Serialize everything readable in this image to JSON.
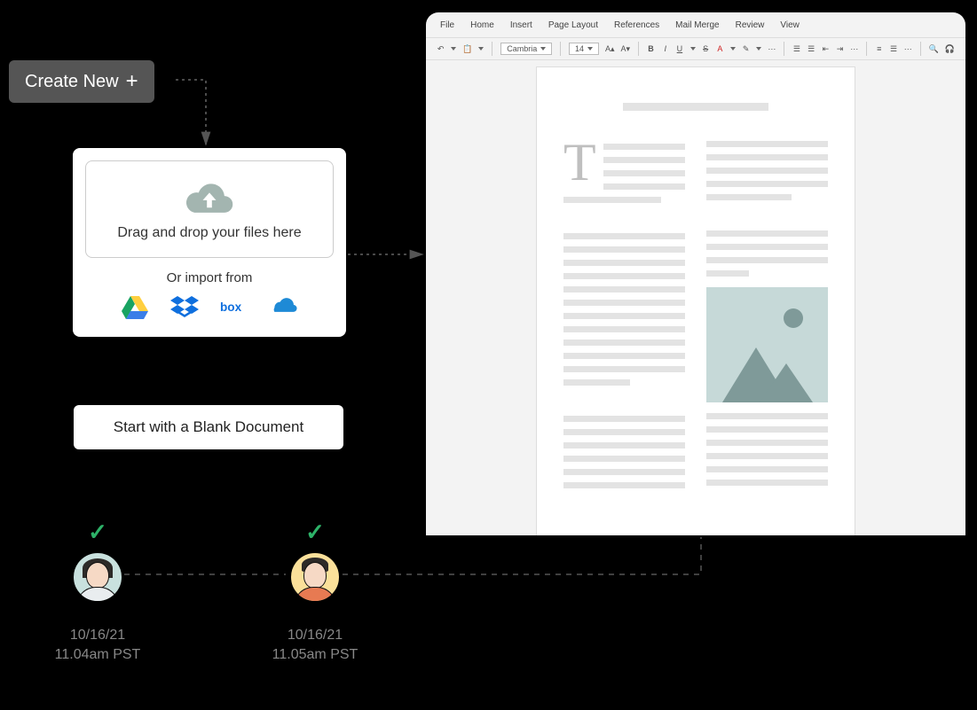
{
  "create_button": {
    "label": "Create New"
  },
  "upload": {
    "drop_text": "Drag and drop your files here",
    "import_label": "Or import from",
    "services": [
      "google-drive",
      "dropbox",
      "box",
      "onedrive"
    ]
  },
  "blank_doc": {
    "label": "Start with a Blank Document"
  },
  "editor": {
    "menu": [
      "File",
      "Home",
      "Insert",
      "Page Layout",
      "References",
      "Mail Merge",
      "Review",
      "View"
    ],
    "font_name": "Cambria",
    "font_size": "14"
  },
  "users": [
    {
      "date": "10/16/21",
      "time": "11.04am PST"
    },
    {
      "date": "10/16/21",
      "time": "11.05am PST"
    }
  ]
}
